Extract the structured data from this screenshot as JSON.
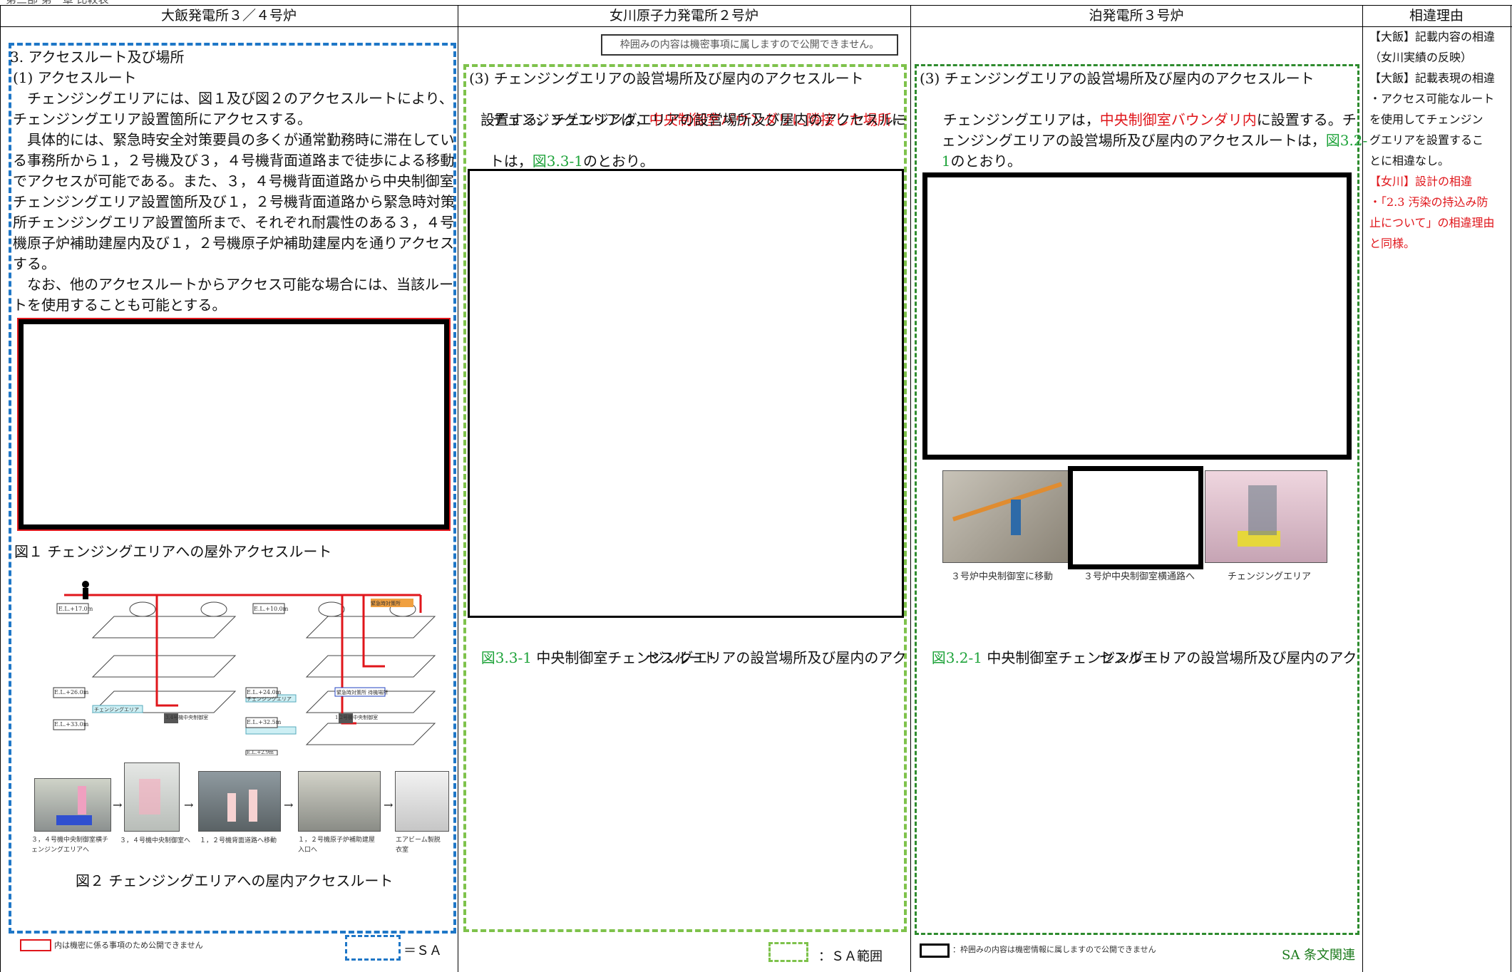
{
  "top_fragment": "第三部 第一章 比較表",
  "columns": {
    "c1": "大飯発電所３／４号炉",
    "c2": "女川原子力発電所２号炉",
    "c3": "泊発電所３号炉",
    "c4": "相違理由"
  },
  "col1": {
    "lines": [
      "3. アクセスルート及び場所",
      "(1) アクセスルート",
      "　チェンジングエリアには、図１及び図２のアクセスルートにより、",
      "チェンジングエリア設置箇所にアクセスする。",
      "　具体的には、緊急時安全対策要員の多くが通常勤務時に滞在してい",
      "る事務所から１，２号機及び３，４号機背面道路まで徒歩による移動",
      "でアクセスが可能である。また、３，４号機背面道路から中央制御室",
      "チェンジングエリア設置箇所及び１，２号機背面道路から緊急時対策",
      "所チェンジングエリア設置箇所まで、それぞれ耐震性のある３，４号",
      "機原子炉補助建屋内及び１，２号機原子炉補助建屋内を通りアクセス",
      "する。",
      "　なお、他のアクセスルートからアクセス可能な場合には、当該ルー",
      "トを使用することも可能とする。"
    ],
    "fig1": "図１ チェンジングエリアへの屋外アクセスルート",
    "fig2": "図２ チェンジングエリアへの屋内アクセスルート",
    "diagram_labels": [
      "E.L.+17.0m",
      "E.L.+33.0m",
      "E.L.+26.0m",
      "E.L.+10.0m",
      "E.L.+24.0m",
      "E.L.+32.5m",
      "E.L.+2.9m",
      "チェンジングエリア",
      "緊急時対策所",
      "チェンジングエリア",
      "3,4号機中央制御室",
      "緊急時対策所 待機場所",
      "1,2号機中央制御室"
    ],
    "photo_captions": [
      "３，４号機中央制御室横チェンジングエリアへ",
      "３，４号機中央制御室へ",
      "１，２号機背面道路へ移動",
      "１，２号機原子炉補助建屋入口へ",
      "エアビーム製脱衣室"
    ],
    "legend_text": "内は機密に係る事項のため公開できません",
    "sa_legend": "＝ＳＡ"
  },
  "col2": {
    "notice": "枠囲みの内容は機密事項に属しますので公開できません。",
    "heading": "(3) チェンジングエリアの設営場所及び屋内のアクセスルート",
    "p1_a": "　チェンジングエリアは，",
    "p1_red": "中央制御室バウンダリに隣接した場所",
    "p1_b": "に",
    "p2": "設置する。チェンジングエリアの設営場所及び屋内のアクセスルー",
    "p3_a": "トは，",
    "p3_grn": "図3.3-1",
    "p3_b": "のとおり。",
    "fig_num": "図3.3-1",
    "fig_title_1": " 中央制御室チェンジングエリアの設営場所及び屋内のアク",
    "fig_title_2": "セスルート",
    "sa_legend": "：ＳＡ範囲"
  },
  "col3": {
    "heading": "(3) チェンジングエリアの設営場所及び屋内のアクセスルート",
    "p1_a": "　チェンジングエリアは，",
    "p1_red": "中央制御室バウンダリ内",
    "p1_b": "に設置する。チ",
    "p2_a": "ェンジングエリアの設営場所及び屋内のアクセスルートは，",
    "p2_grn": "図3.2-",
    "p3_grn": "1",
    "p3_b": "のとおり。",
    "photo_captions": [
      "３号炉中央制御室に移動",
      "３号炉中央制御室横通路へ",
      "チェンジングエリア"
    ],
    "fig_num": "図3.2-1",
    "fig_title_1": " 中央制御室チェンジングエリアの設営場所及び屋内のアク",
    "fig_title_2": "セスルート",
    "legend_text": "：枠囲みの内容は機密情報に属しますので公開できません",
    "sa_legend": "SA 条文関連"
  },
  "col4": {
    "lines_black": [
      "【大飯】記載内容の相違",
      "（女川実績の反映）",
      "【大飯】記載表現の相違",
      "・アクセス可能なルート",
      "を使用してチェンジン",
      "グエリアを設置するこ",
      "とに相違なし。"
    ],
    "lines_red": [
      "【女川】設計の相違",
      "・「2.3 汚染の持込み防",
      "止について」の相違理由",
      "と同様。"
    ]
  }
}
